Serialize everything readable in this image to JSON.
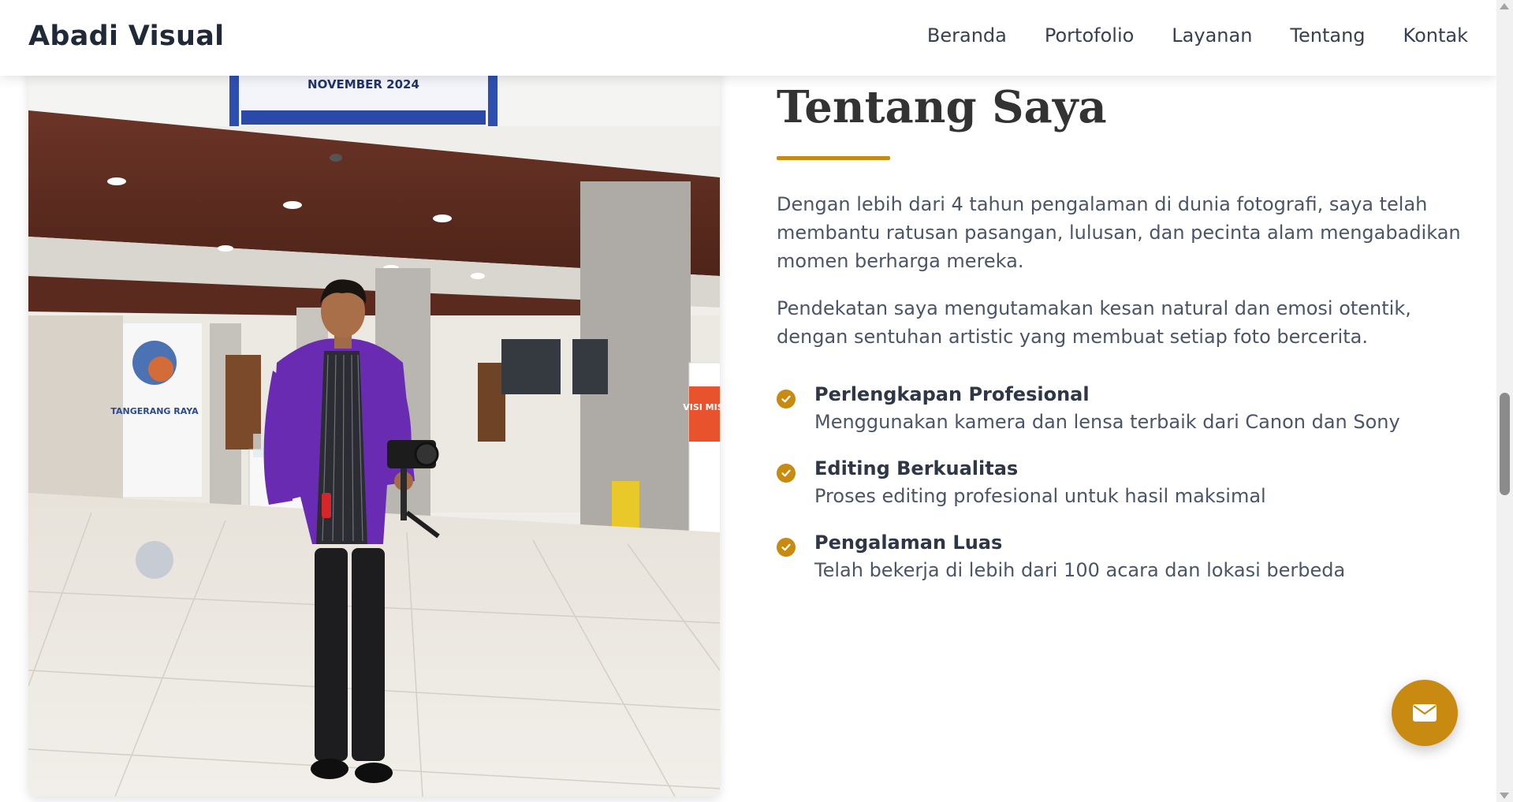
{
  "navbar": {
    "brand": "Abadi Visual",
    "links": [
      "Beranda",
      "Portofolio",
      "Layanan",
      "Tentang",
      "Kontak"
    ]
  },
  "about": {
    "title": "Tentang Saya",
    "paragraphs": [
      "Dengan lebih dari 4 tahun pengalaman di dunia fotografi, saya telah membantu ratusan pasangan, lulusan, dan pecinta alam mengabadikan momen berharga mereka.",
      "Pendekatan saya mengutamakan kesan natural dan emosi otentik, dengan sentuhan artistic yang membuat setiap foto bercerita."
    ],
    "features": [
      {
        "title": "Perlengkapan Profesional",
        "description": "Menggunakan kamera dan lensa terbaik dari Canon dan Sony"
      },
      {
        "title": "Editing Berkualitas",
        "description": "Proses editing profesional untuk hasil maksimal"
      },
      {
        "title": "Pengalaman Luas",
        "description": "Telah bekerja di lebih dari 100 acara dan lokasi berbeda"
      }
    ]
  },
  "photo": {
    "banner_text": "NOVEMBER 2024",
    "wall_logo_text": "TANGERANG RAYA",
    "side_banner_text": "VISI MISI"
  },
  "icons": {
    "feature_check": "check-circle-icon",
    "contact_fab": "envelope-icon"
  },
  "colors": {
    "accent": "#c98a12",
    "heading": "#333333",
    "text": "#4a5568"
  }
}
